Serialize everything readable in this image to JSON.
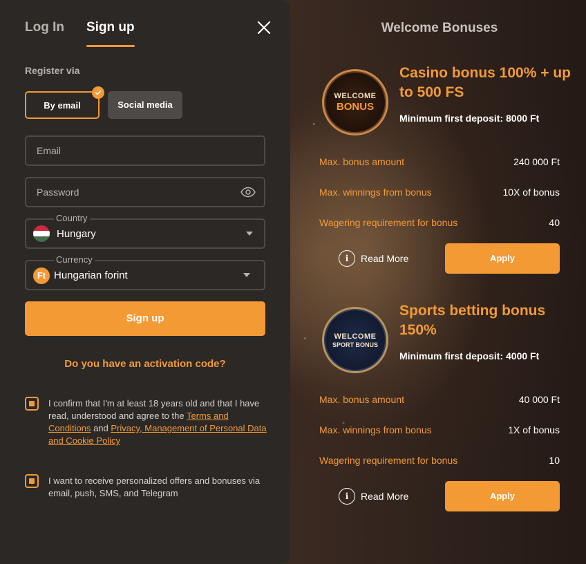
{
  "auth": {
    "tabs": [
      {
        "label": "Log In",
        "active": false
      },
      {
        "label": "Sign up",
        "active": true
      }
    ],
    "register_via_label": "Register via",
    "methods": [
      {
        "label": "By email",
        "selected": true
      },
      {
        "label": "Social media",
        "selected": false
      }
    ],
    "email": {
      "placeholder": "Email",
      "value": ""
    },
    "password": {
      "placeholder": "Password",
      "value": ""
    },
    "country": {
      "label": "Country",
      "value": "Hungary",
      "flag_colors": [
        "#cd2a3e",
        "#ffffff",
        "#436f4d"
      ]
    },
    "currency": {
      "label": "Currency",
      "value": "Hungarian forint",
      "symbol": "Ft"
    },
    "signup_button": "Sign up",
    "activation_code_link": "Do you have an activation code?",
    "consent_age": {
      "text": "I confirm that I'm at least 18 years old and that I have read, understood and agree to the",
      "terms_link": "Terms and Conditions",
      "and": "and",
      "privacy_link": "Privacy, Management of Personal Data and Cookie Policy",
      "checked": true
    },
    "consent_offers": {
      "text": "I want to receive personalized offers and bonuses via email, push, SMS, and Telegram",
      "checked": true
    }
  },
  "bonuses": {
    "title": "Welcome Bonuses",
    "items": [
      {
        "badge_line1": "WELCOME",
        "badge_line2": "BONUS",
        "title": "Casino bonus 100% + up to 500 FS",
        "min_deposit": "Minimum first deposit: 8000 Ft",
        "rows": [
          {
            "label": "Max. bonus amount",
            "value": "240 000 Ft"
          },
          {
            "label": "Max. winnings from bonus",
            "value": "10X of bonus"
          },
          {
            "label": "Wagering requirement for bonus",
            "value": "40"
          }
        ],
        "read_more": "Read More",
        "apply": "Apply"
      },
      {
        "badge_line1": "WELCOME",
        "badge_line2": "SPORT BONUS",
        "title": "Sports betting bonus 150%",
        "min_deposit": "Minimum first deposit: 4000 Ft",
        "rows": [
          {
            "label": "Max. bonus amount",
            "value": "40 000 Ft"
          },
          {
            "label": "Max. winnings from bonus",
            "value": "1X of bonus"
          },
          {
            "label": "Wagering requirement for bonus",
            "value": "10"
          }
        ],
        "read_more": "Read More",
        "apply": "Apply"
      }
    ]
  },
  "colors": {
    "accent": "#f39a35",
    "panel": "#2b2826",
    "field_border": "#4e4a47"
  }
}
